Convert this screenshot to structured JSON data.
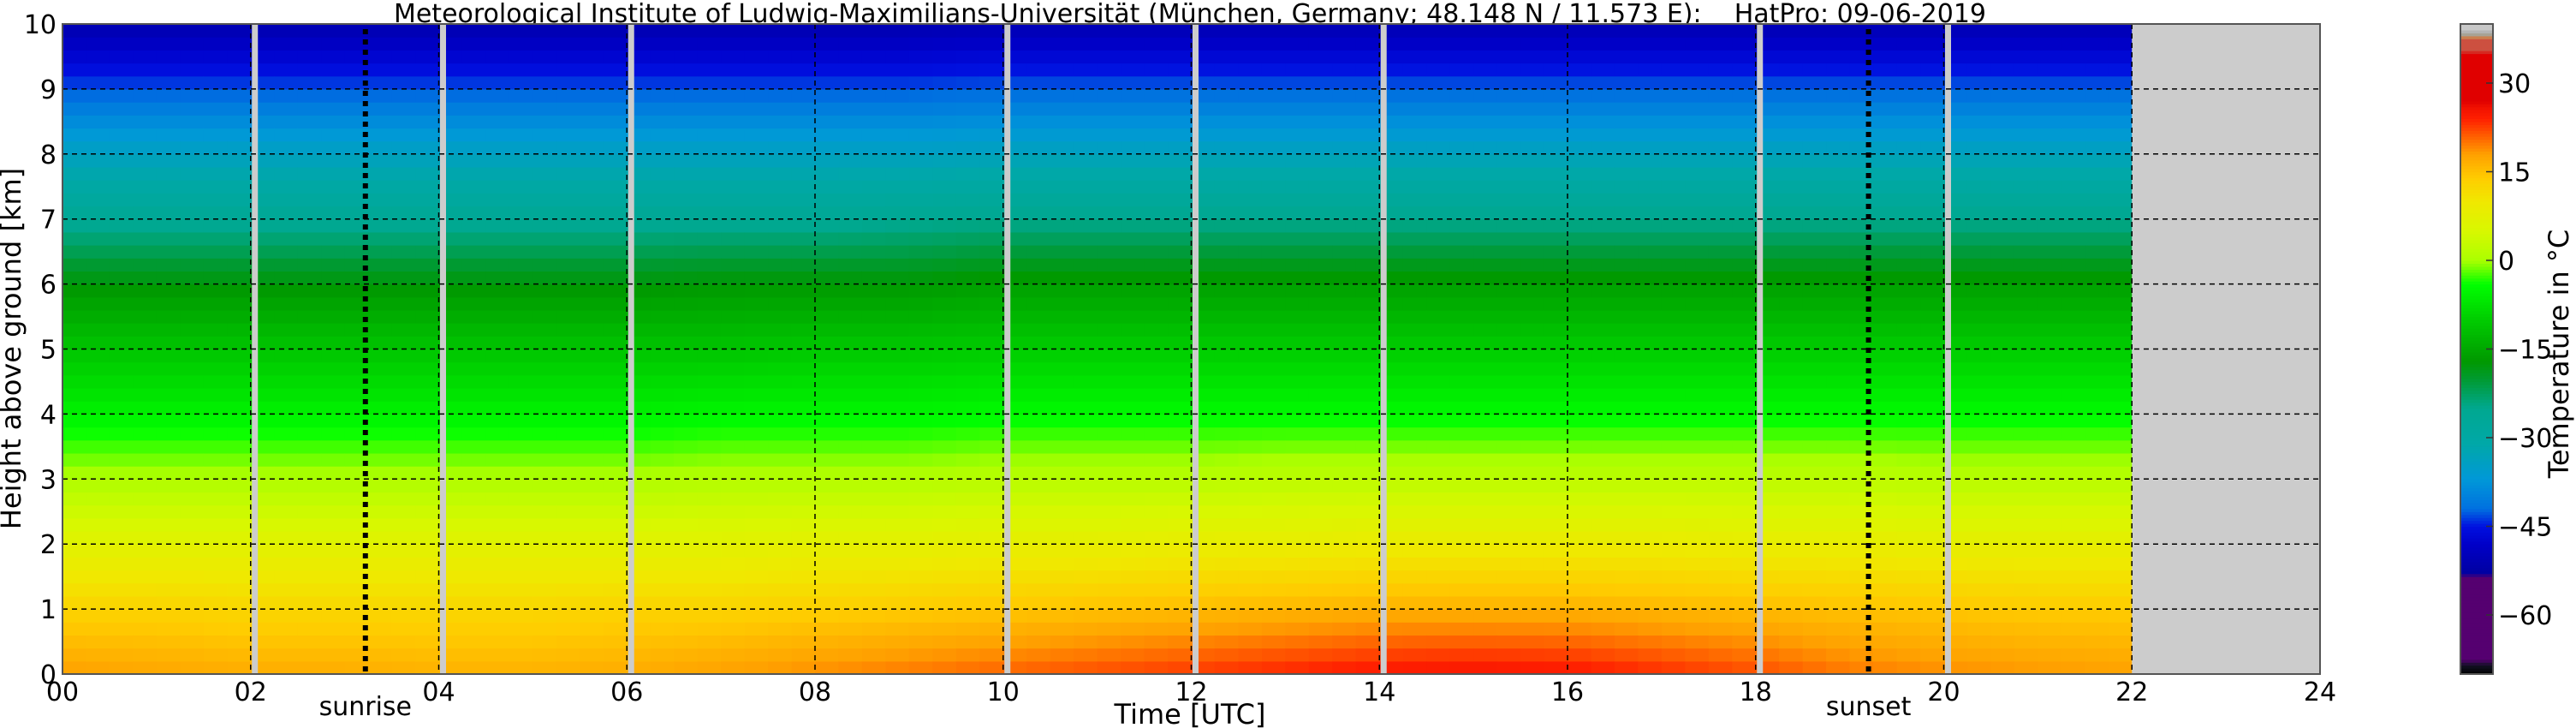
{
  "chart_data": {
    "type": "heatmap",
    "title": "Meteorological Institute of Ludwig-Maximilians-Universität (München, Germany; 48.148 N / 11.573 E):    HatPro: 09-06-2019",
    "xlabel": "Time [UTC]",
    "ylabel": "Height above ground [km]",
    "colorbar_label": "Temperature in °C",
    "xlim": [
      0,
      24
    ],
    "ylim": [
      0,
      10
    ],
    "clim": [
      -70,
      40
    ],
    "grid": true,
    "x_tick_labels": [
      "00",
      "02",
      "04",
      "06",
      "08",
      "10",
      "12",
      "14",
      "16",
      "18",
      "20",
      "22",
      "24"
    ],
    "x_ticks": [
      0,
      2,
      4,
      6,
      8,
      10,
      12,
      14,
      16,
      18,
      20,
      22,
      24
    ],
    "y_ticks": [
      0,
      1,
      2,
      3,
      4,
      5,
      6,
      7,
      8,
      9,
      10
    ],
    "y_tick_labels": [
      "0",
      "1",
      "2",
      "3",
      "4",
      "5",
      "6",
      "7",
      "8",
      "9",
      "10"
    ],
    "colorbar_ticks": [
      30,
      15,
      0,
      -15,
      -30,
      -45,
      -60
    ],
    "colorbar_tick_labels": [
      "30",
      "15",
      "0",
      "−15",
      "−30",
      "−45",
      "−60"
    ],
    "annotations": [
      {
        "label": "sunrise",
        "time_utc": 3.22
      },
      {
        "label": "sunset",
        "time_utc": 19.2
      }
    ],
    "data_gaps_utc": [
      2.05,
      4.05,
      6.05,
      10.05,
      12.05,
      14.05,
      18.05,
      20.05
    ],
    "no_data_after_utc": 22,
    "no_data_color": "#cccccc",
    "times_utc": [
      0,
      1,
      2,
      3,
      4,
      5,
      6,
      7,
      8,
      9,
      10,
      11,
      12,
      13,
      14,
      15,
      16,
      17,
      18,
      19,
      20,
      21,
      22
    ],
    "heights_km": [
      0,
      1,
      2,
      3,
      4,
      5,
      6,
      7,
      8,
      9,
      10
    ],
    "temperature_c": [
      [
        18,
        17.5,
        17,
        17,
        16.5,
        16.5,
        17,
        18,
        19,
        20,
        21,
        22,
        23,
        24,
        25,
        25.5,
        25,
        23.5,
        22,
        20,
        19,
        18.5,
        18
      ],
      [
        13,
        13,
        12.5,
        12.5,
        12.5,
        12.5,
        13,
        13,
        13.5,
        14,
        14.5,
        15,
        15.5,
        16,
        16.5,
        16.5,
        16.5,
        16,
        15.5,
        15,
        14.5,
        14,
        14
      ],
      [
        7,
        7,
        7,
        7,
        7,
        7,
        7,
        7,
        7.5,
        7.5,
        8,
        8,
        8.5,
        8.5,
        9,
        9,
        9,
        9,
        8.5,
        8.5,
        8,
        8,
        8
      ],
      [
        0.5,
        0.5,
        0.5,
        0.5,
        0.5,
        0.5,
        0.5,
        1,
        1,
        1,
        1.5,
        1.5,
        1.5,
        2,
        2,
        2,
        2,
        2,
        2,
        2,
        1.5,
        1.5,
        1.5
      ],
      [
        -5.5,
        -5.5,
        -5.5,
        -5.5,
        -5.5,
        -5.5,
        -5.5,
        -5,
        -5,
        -5,
        -4.5,
        -4.5,
        -4.5,
        -4.5,
        -4.5,
        -4.5,
        -4.5,
        -4.5,
        -4.5,
        -4.5,
        -4.5,
        -4.5,
        -4.5
      ],
      [
        -11,
        -11,
        -11,
        -11,
        -11,
        -11,
        -11,
        -11,
        -10.5,
        -10.5,
        -10,
        -10,
        -10,
        -10,
        -10,
        -10,
        -10,
        -10,
        -10,
        -10,
        -10,
        -10,
        -10
      ],
      [
        -17.5,
        -17.5,
        -17.5,
        -17.5,
        -17.5,
        -17.5,
        -17.5,
        -17,
        -17,
        -17,
        -16,
        -16,
        -16,
        -16,
        -16,
        -16,
        -16,
        -16,
        -16,
        -16,
        -16,
        -16,
        -16
      ],
      [
        -26,
        -26,
        -26,
        -26,
        -26,
        -26,
        -26,
        -26,
        -26,
        -25.5,
        -25,
        -25,
        -25,
        -25,
        -25,
        -25,
        -25,
        -25,
        -25,
        -25,
        -25,
        -25,
        -25
      ],
      [
        -34,
        -34,
        -34,
        -34,
        -34,
        -34,
        -34,
        -34,
        -34,
        -34,
        -33.5,
        -33.5,
        -33.5,
        -33.5,
        -33.5,
        -33.5,
        -33.5,
        -33.5,
        -33.5,
        -33.5,
        -33.5,
        -33.5,
        -33.5
      ],
      [
        -43,
        -43,
        -43,
        -43,
        -43,
        -43,
        -43,
        -43,
        -43,
        -43,
        -42.5,
        -42.5,
        -42.5,
        -42.5,
        -42.5,
        -42.5,
        -42.5,
        -42.5,
        -42.5,
        -42.5,
        -42.5,
        -42.5,
        -42.5
      ],
      [
        -51,
        -51,
        -51,
        -51,
        -51,
        -51,
        -51,
        -51,
        -51,
        -51,
        -50.5,
        -50.5,
        -50.5,
        -50.5,
        -50.5,
        -50.5,
        -50.5,
        -50.5,
        -50.5,
        -50.5,
        -50.5,
        -50.5,
        -50.5
      ]
    ],
    "colormap": [
      {
        "t": -70,
        "c": "#000000"
      },
      {
        "t": -68.5,
        "c": "#111122"
      },
      {
        "t": -67.5,
        "c": "#550070"
      },
      {
        "t": -53.5,
        "c": "#550070"
      },
      {
        "t": -53,
        "c": "#0000a0"
      },
      {
        "t": -48,
        "c": "#0000c8"
      },
      {
        "t": -45,
        "c": "#0010e0"
      },
      {
        "t": -42,
        "c": "#0070e0"
      },
      {
        "t": -37,
        "c": "#0098d8"
      },
      {
        "t": -31,
        "c": "#00a8a8"
      },
      {
        "t": -25,
        "c": "#00a890"
      },
      {
        "t": -20,
        "c": "#009a30"
      },
      {
        "t": -17,
        "c": "#009900"
      },
      {
        "t": -10,
        "c": "#00cc00"
      },
      {
        "t": -4,
        "c": "#00ff00"
      },
      {
        "t": 0,
        "c": "#aaff00"
      },
      {
        "t": 5,
        "c": "#d8f800"
      },
      {
        "t": 10,
        "c": "#f0e800"
      },
      {
        "t": 14,
        "c": "#ffcc00"
      },
      {
        "t": 18,
        "c": "#ffa000"
      },
      {
        "t": 21,
        "c": "#ff6000"
      },
      {
        "t": 24,
        "c": "#ff2000"
      },
      {
        "t": 26,
        "c": "#f01000"
      },
      {
        "t": 27,
        "c": "#e00000"
      },
      {
        "t": 35,
        "c": "#e00000"
      },
      {
        "t": 35.5,
        "c": "#cc5040"
      },
      {
        "t": 37.5,
        "c": "#cc5040"
      },
      {
        "t": 38,
        "c": "#c8b060"
      },
      {
        "t": 38.3,
        "c": "#a0a0a0"
      },
      {
        "t": 39.2,
        "c": "#c8c8c8"
      },
      {
        "t": 40,
        "c": "#c8c8c8"
      }
    ]
  }
}
